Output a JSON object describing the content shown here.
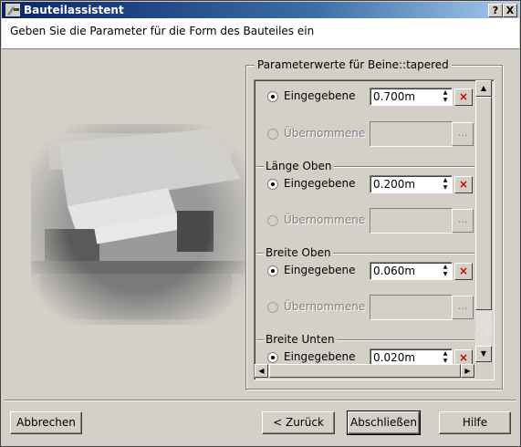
{
  "window": {
    "title": "Bauteilassistent",
    "help_button": "?",
    "close_button": "X"
  },
  "header": {
    "instruction": "Geben Sie die Parameter für die Form des Bauteiles ein"
  },
  "params": {
    "group_title": "Parameterwerte für Beine::tapered",
    "sections": [
      {
        "title": "",
        "entered_label": "Eingegebene",
        "value": "0.700m",
        "taken_label": "Übernommene"
      },
      {
        "title": "Länge Oben",
        "entered_label": "Eingegebene",
        "value": "0.200m",
        "taken_label": "Übernommene"
      },
      {
        "title": "Breite Oben",
        "entered_label": "Eingegebene",
        "value": "0.060m",
        "taken_label": "Übernommene"
      },
      {
        "title": "Breite Unten",
        "entered_label": "Eingegebene",
        "value": "0.020m"
      }
    ],
    "clear_glyph": "×",
    "browse_glyph": "..."
  },
  "buttons": {
    "cancel": "Abbrechen",
    "back": "< Zurück",
    "finish": "Abschließen",
    "help": "Hilfe"
  }
}
